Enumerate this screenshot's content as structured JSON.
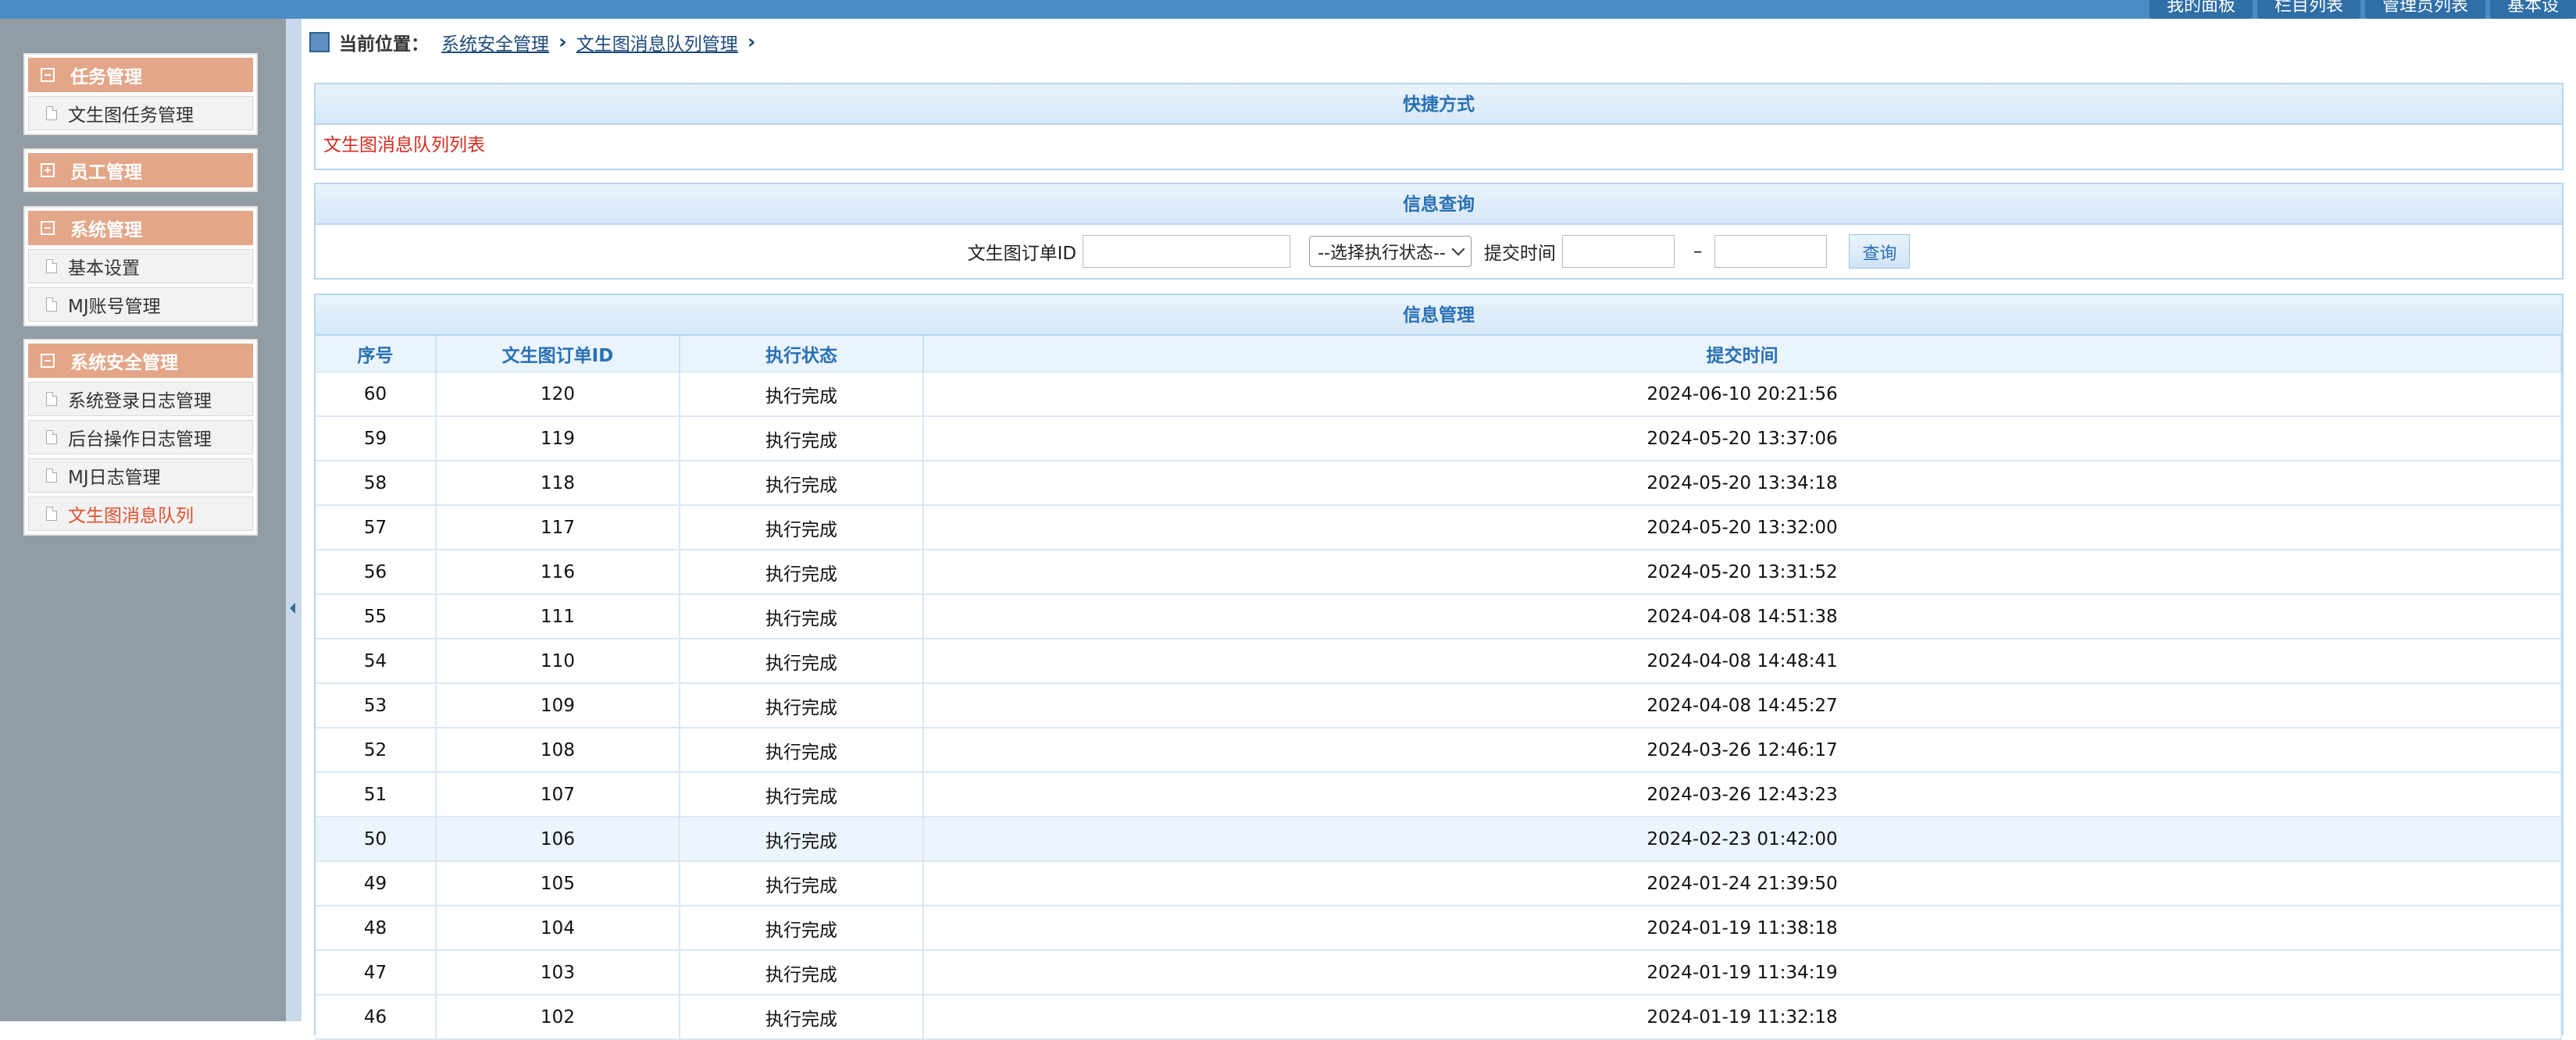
{
  "topnav": [
    "我的面板",
    "栏目列表",
    "管理员列表",
    "基本设"
  ],
  "sidebar": {
    "groups": [
      {
        "title": "任务管理",
        "expanded": true,
        "items": [
          {
            "label": "文生图任务管理",
            "active": false
          }
        ]
      },
      {
        "title": "员工管理",
        "expanded": false,
        "items": []
      },
      {
        "title": "系统管理",
        "expanded": true,
        "items": [
          {
            "label": "基本设置",
            "active": false
          },
          {
            "label": "MJ账号管理",
            "active": false
          }
        ]
      },
      {
        "title": "系统安全管理",
        "expanded": true,
        "items": [
          {
            "label": "系统登录日志管理",
            "active": false
          },
          {
            "label": "后台操作日志管理",
            "active": false
          },
          {
            "label": "MJ日志管理",
            "active": false
          },
          {
            "label": "文生图消息队列",
            "active": true
          }
        ]
      }
    ]
  },
  "breadcrumb": {
    "label": "当前位置：",
    "links": [
      "系统安全管理",
      "文生图消息队列管理"
    ]
  },
  "shortcut": {
    "title": "快捷方式",
    "link": "文生图消息队列列表"
  },
  "query": {
    "title": "信息查询",
    "order_id_label": "文生图订单ID",
    "status_select": "--选择执行状态--",
    "time_label": "提交时间",
    "dash": "–",
    "button": "查询"
  },
  "table": {
    "title": "信息管理",
    "columns": [
      "序号",
      "文生图订单ID",
      "执行状态",
      "提交时间"
    ],
    "highlighted_row": 10,
    "rows": [
      [
        "60",
        "120",
        "执行完成",
        "2024-06-10 20:21:56"
      ],
      [
        "59",
        "119",
        "执行完成",
        "2024-05-20 13:37:06"
      ],
      [
        "58",
        "118",
        "执行完成",
        "2024-05-20 13:34:18"
      ],
      [
        "57",
        "117",
        "执行完成",
        "2024-05-20 13:32:00"
      ],
      [
        "56",
        "116",
        "执行完成",
        "2024-05-20 13:31:52"
      ],
      [
        "55",
        "111",
        "执行完成",
        "2024-04-08 14:51:38"
      ],
      [
        "54",
        "110",
        "执行完成",
        "2024-04-08 14:48:41"
      ],
      [
        "53",
        "109",
        "执行完成",
        "2024-04-08 14:45:27"
      ],
      [
        "52",
        "108",
        "执行完成",
        "2024-03-26 12:46:17"
      ],
      [
        "51",
        "107",
        "执行完成",
        "2024-03-26 12:43:23"
      ],
      [
        "50",
        "106",
        "执行完成",
        "2024-02-23 01:42:00"
      ],
      [
        "49",
        "105",
        "执行完成",
        "2024-01-24 21:39:50"
      ],
      [
        "48",
        "104",
        "执行完成",
        "2024-01-19 11:38:18"
      ],
      [
        "47",
        "103",
        "执行完成",
        "2024-01-19 11:34:19"
      ],
      [
        "46",
        "102",
        "执行完成",
        "2024-01-19 11:32:18"
      ]
    ]
  }
}
